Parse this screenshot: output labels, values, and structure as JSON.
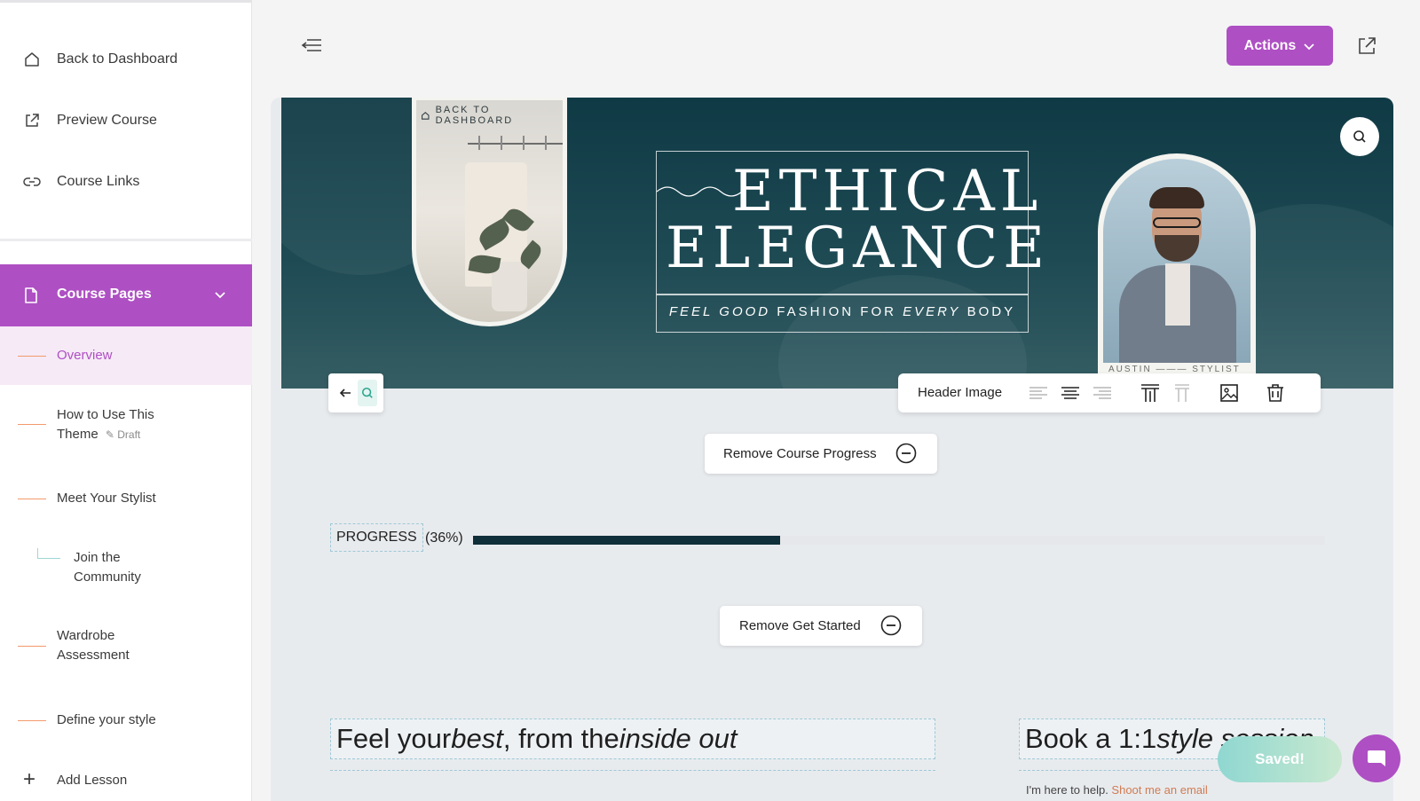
{
  "sidebar": {
    "top_items": [
      {
        "label": "Back to Dashboard",
        "icon": "home-icon"
      },
      {
        "label": "Preview Course",
        "icon": "external-link-icon"
      },
      {
        "label": "Course Links",
        "icon": "link-icon"
      }
    ],
    "section": {
      "label": "Course Pages",
      "icon": "page-icon"
    },
    "lessons": [
      {
        "label": "Overview"
      },
      {
        "label_line1": "How to Use This",
        "label_line2": "Theme",
        "badge": "Draft"
      },
      {
        "label": "Meet Your Stylist"
      },
      {
        "label_line1": "Join the",
        "label_line2": "Community"
      },
      {
        "label_line1": "Wardrobe",
        "label_line2": "Assessment"
      },
      {
        "label": "Define your style"
      }
    ],
    "add_lesson": "Add Lesson"
  },
  "topbar": {
    "actions_label": "Actions"
  },
  "hero": {
    "back_link": "BACK TO DASHBOARD",
    "title_line1": "ETHICAL",
    "title_line2": "ELEGANCE",
    "subtitle_part1": "FEEL GOOD",
    "subtitle_part2": " FASHION FOR ",
    "subtitle_part3": "EVERY",
    "subtitle_part4": " BODY",
    "nameplate": "AUSTIN ——— STYLIST"
  },
  "header_toolbar": {
    "title": "Header Image"
  },
  "buttons": {
    "remove_progress": "Remove Course Progress",
    "remove_get_started": "Remove Get Started"
  },
  "progress": {
    "label": "PROGRESS",
    "percent_text": "(36%)",
    "value": 0.36
  },
  "content": {
    "heading_left_1": "Feel your ",
    "heading_left_2": "best",
    "heading_left_3": ", from the ",
    "heading_left_4": "inside out",
    "heading_right_1": "Book a 1:1 ",
    "heading_right_2": "style session",
    "small_text_1": "I'm here to help. ",
    "small_text_2": "Shoot me an email"
  },
  "status": {
    "saved": "Saved!"
  },
  "colors": {
    "accent": "#ae4fc3",
    "hero_bg": "#0f3a45",
    "progress_fill": "#0f2f3a",
    "lesson_dash": "#f29a6c"
  }
}
